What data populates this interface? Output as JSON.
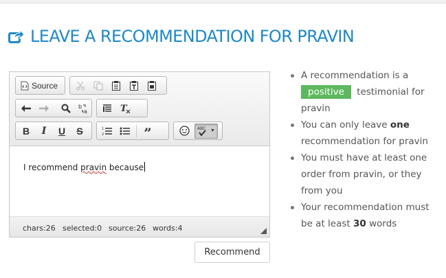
{
  "heading": {
    "title": "LEAVE A RECOMMENDATION FOR PRAVIN",
    "icon": "share-square-icon",
    "color": "#1e88c7"
  },
  "editor": {
    "toolbar": {
      "source_label": "Source"
    },
    "content": {
      "text_before": "I recommend ",
      "misspelled_word": "pravin",
      "text_after": " because"
    },
    "status": {
      "chars": "chars:26",
      "selected": "selected:0",
      "source": "source:26",
      "words": "words:4"
    }
  },
  "recommend_button": {
    "label": "Recommend"
  },
  "info": {
    "item1": {
      "pre": "A recommendation is a",
      "badge": "positive",
      "post": "testimonial for pravin"
    },
    "item2": {
      "pre": "You can only leave",
      "bold": "one",
      "post": "recommendation for pravin"
    },
    "item3": {
      "text": "You must have at least one order from pravin, or they from you"
    },
    "item4": {
      "pre": "Your recommendation must be at least",
      "bold": "30",
      "post": "words"
    },
    "badge_color": "#5cb85c"
  }
}
